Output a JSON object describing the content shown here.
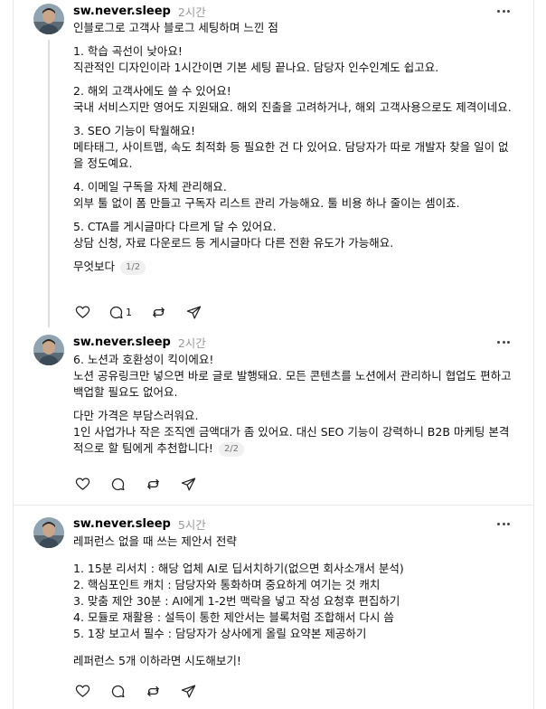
{
  "posts": [
    {
      "username": "sw.never.sleep",
      "time": "2시간",
      "lines": [
        "인블로그로 고객사 블로그 세팅하며 느낀 점",
        "",
        "1. 학습 곡선이 낮아요!",
        "직관적인 디자인이라 1시간이면 기본 세팅 끝나요. 담당자 인수인계도 쉽고요.",
        "",
        "2. 해외 고객사에도 쓸 수 있어요!",
        "국내 서비스지만 영어도 지원돼요. 해외 진출을 고려하거나, 해외 고객사용으로도 제격이네요.",
        "",
        "3. SEO 기능이 탁월해요!",
        "메타태그, 사이트맵, 속도 최적화 등 필요한 건 다 있어요. 담당자가 따로 개발자 찾을 일이 없",
        "을 정도예요.",
        "",
        "4. 이메일 구독을 자체 관리해요.",
        "외부 툴 없이 폼 만들고 구독자 리스트 관리 가능해요. 툴 비용 하나 줄이는 셈이죠.",
        "",
        "5. CTA를 게시글마다 다르게 달 수 있어요.",
        "상담 신청, 자료 다운로드 등 게시글마다 다른 전환 유도가 가능해요.",
        "",
        "무엇보다"
      ],
      "page": "1/2",
      "reply_count": "1"
    },
    {
      "username": "sw.never.sleep",
      "time": "2시간",
      "lines": [
        "6. 노션과 호환성이 킥이에요!",
        "노션 공유링크만 넣으면 바로 글로 발행돼요. 모든 콘텐츠를 노션에서 관리하니 협업도 편하고",
        "백업할 필요도 없어요.",
        "",
        "다만 가격은 부담스러워요.",
        "1인 사업가나 작은 조직엔 금액대가 좀 있어요. 대신 SEO 기능이 강력하니 B2B 마케팅 본격",
        "적으로 할 팀에게 추천합니다!"
      ],
      "page": "2/2",
      "reply_count": ""
    },
    {
      "username": "sw.never.sleep",
      "time": "5시간",
      "lines": [
        "레퍼런스 없을 때 쓰는 제안서 전략",
        "",
        "1. 15분 리서치 : 해당 업체 AI로 딥서치하기(없으면 회사소개서 분석)",
        "2. 핵심포인트 캐치 : 담당자와 통화하며 중요하게 여기는 것 캐치",
        "3. 맞춤 제안 30분 : AI에게 1-2번 맥락을 넣고 작성 요청후 편집하기",
        "4. 모듈로 재활용 : 설득이 통한 제안서는 블록처럼 조합해서 다시 씀",
        "5. 1장 보고서 필수 : 담당자가 상사에게 올릴 요약본 제공하기",
        "",
        "레퍼런스 5개 이하라면 시도해보기!"
      ],
      "page": "",
      "reply_count": ""
    }
  ],
  "icons": {
    "like": "heart-icon",
    "reply": "comment-icon",
    "repost": "repost-icon",
    "share": "send-icon",
    "more": "more-icon"
  }
}
